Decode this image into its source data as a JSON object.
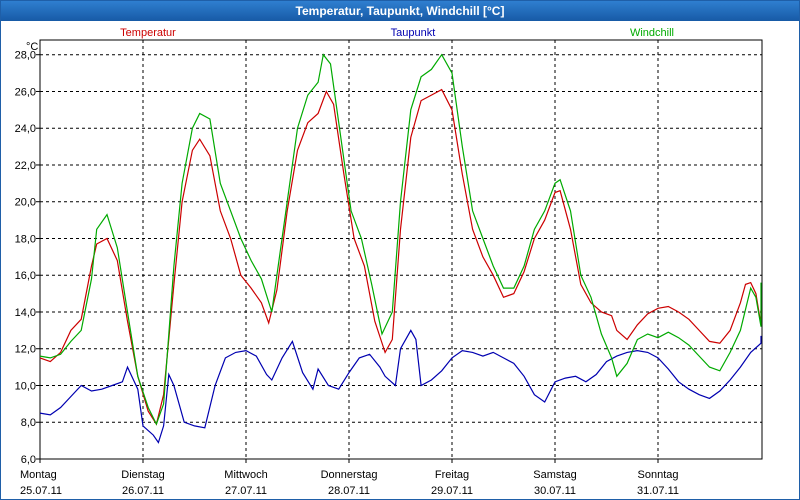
{
  "window": {
    "title": "Temperatur, Taupunkt, Windchill [°C]"
  },
  "chart_data": {
    "type": "line",
    "title": "Temperatur, Taupunkt, Windchill [°C]",
    "ylabel": "°C",
    "ylim": [
      6,
      28.8
    ],
    "yticks": [
      6,
      8,
      10,
      12,
      14,
      16,
      18,
      20,
      22,
      24,
      26,
      28
    ],
    "ytick_labels": [
      "6,0",
      "8,0",
      "10,0",
      "12,0",
      "14,0",
      "16,0",
      "18,0",
      "20,0",
      "22,0",
      "24,0",
      "26,0",
      "28,0"
    ],
    "xlim": [
      0,
      7.05
    ],
    "x_ticks": [
      {
        "x": 0,
        "day": "Montag",
        "date": "25.07.11"
      },
      {
        "x": 1,
        "day": "Dienstag",
        "date": "26.07.11"
      },
      {
        "x": 2,
        "day": "Mittwoch",
        "date": "27.07.11"
      },
      {
        "x": 3,
        "day": "Donnerstag",
        "date": "28.07.11"
      },
      {
        "x": 4,
        "day": "Freitag",
        "date": "29.07.11"
      },
      {
        "x": 5,
        "day": "Samstag",
        "date": "30.07.11"
      },
      {
        "x": 6,
        "day": "Sonntag",
        "date": "31.07.11"
      }
    ],
    "grid": true,
    "legend_position": "top",
    "series": [
      {
        "name": "Temperatur",
        "color": "#cc0000",
        "points": [
          [
            0.0,
            11.5
          ],
          [
            0.1,
            11.3
          ],
          [
            0.2,
            11.8
          ],
          [
            0.3,
            13.0
          ],
          [
            0.4,
            13.6
          ],
          [
            0.5,
            16.5
          ],
          [
            0.55,
            17.7
          ],
          [
            0.65,
            18.0
          ],
          [
            0.75,
            16.8
          ],
          [
            0.85,
            13.5
          ],
          [
            0.95,
            10.5
          ],
          [
            1.05,
            8.6
          ],
          [
            1.13,
            7.9
          ],
          [
            1.2,
            9.5
          ],
          [
            1.3,
            15.5
          ],
          [
            1.38,
            20.0
          ],
          [
            1.48,
            22.8
          ],
          [
            1.55,
            23.4
          ],
          [
            1.65,
            22.5
          ],
          [
            1.75,
            19.5
          ],
          [
            1.85,
            18.0
          ],
          [
            1.95,
            16.0
          ],
          [
            2.05,
            15.3
          ],
          [
            2.15,
            14.5
          ],
          [
            2.22,
            13.4
          ],
          [
            2.3,
            15.2
          ],
          [
            2.4,
            19.5
          ],
          [
            2.5,
            22.8
          ],
          [
            2.6,
            24.3
          ],
          [
            2.7,
            24.8
          ],
          [
            2.78,
            26.0
          ],
          [
            2.85,
            25.3
          ],
          [
            2.95,
            21.5
          ],
          [
            3.05,
            18.0
          ],
          [
            3.15,
            16.5
          ],
          [
            3.25,
            13.5
          ],
          [
            3.35,
            11.8
          ],
          [
            3.42,
            12.5
          ],
          [
            3.5,
            18.5
          ],
          [
            3.6,
            23.5
          ],
          [
            3.7,
            25.5
          ],
          [
            3.8,
            25.8
          ],
          [
            3.9,
            26.1
          ],
          [
            4.0,
            25.0
          ],
          [
            4.1,
            21.5
          ],
          [
            4.2,
            18.5
          ],
          [
            4.3,
            17.0
          ],
          [
            4.4,
            16.0
          ],
          [
            4.5,
            14.8
          ],
          [
            4.6,
            15.0
          ],
          [
            4.7,
            16.2
          ],
          [
            4.8,
            18.0
          ],
          [
            4.9,
            19.0
          ],
          [
            5.0,
            20.5
          ],
          [
            5.05,
            20.6
          ],
          [
            5.15,
            18.5
          ],
          [
            5.25,
            15.5
          ],
          [
            5.35,
            14.5
          ],
          [
            5.45,
            14.0
          ],
          [
            5.55,
            13.8
          ],
          [
            5.6,
            13.0
          ],
          [
            5.7,
            12.5
          ],
          [
            5.8,
            13.3
          ],
          [
            5.9,
            13.9
          ],
          [
            6.0,
            14.2
          ],
          [
            6.1,
            14.3
          ],
          [
            6.2,
            14.0
          ],
          [
            6.3,
            13.6
          ],
          [
            6.4,
            13.0
          ],
          [
            6.5,
            12.4
          ],
          [
            6.6,
            12.3
          ],
          [
            6.7,
            13.0
          ],
          [
            6.8,
            14.5
          ],
          [
            6.85,
            15.5
          ],
          [
            6.9,
            15.6
          ],
          [
            6.95,
            15.0
          ],
          [
            7.0,
            13.3
          ],
          [
            7.05,
            13.5
          ],
          [
            7.15,
            14.1
          ],
          [
            7.25,
            14.0
          ],
          [
            7.35,
            13.6
          ],
          [
            7.45,
            13.5
          ]
        ]
      },
      {
        "name": "Taupunkt",
        "color": "#0000b0",
        "points": [
          [
            0.0,
            8.5
          ],
          [
            0.1,
            8.4
          ],
          [
            0.2,
            8.8
          ],
          [
            0.3,
            9.4
          ],
          [
            0.4,
            10.0
          ],
          [
            0.5,
            9.7
          ],
          [
            0.6,
            9.8
          ],
          [
            0.7,
            10.0
          ],
          [
            0.8,
            10.2
          ],
          [
            0.85,
            11.0
          ],
          [
            0.95,
            9.8
          ],
          [
            1.0,
            7.8
          ],
          [
            1.1,
            7.3
          ],
          [
            1.15,
            6.9
          ],
          [
            1.2,
            7.8
          ],
          [
            1.25,
            10.6
          ],
          [
            1.3,
            10.0
          ],
          [
            1.4,
            8.0
          ],
          [
            1.5,
            7.8
          ],
          [
            1.6,
            7.7
          ],
          [
            1.7,
            10.0
          ],
          [
            1.8,
            11.5
          ],
          [
            1.9,
            11.8
          ],
          [
            2.0,
            11.9
          ],
          [
            2.1,
            11.6
          ],
          [
            2.2,
            10.6
          ],
          [
            2.25,
            10.3
          ],
          [
            2.35,
            11.5
          ],
          [
            2.45,
            12.4
          ],
          [
            2.55,
            10.7
          ],
          [
            2.65,
            9.8
          ],
          [
            2.7,
            10.9
          ],
          [
            2.8,
            10.0
          ],
          [
            2.9,
            9.8
          ],
          [
            3.0,
            10.7
          ],
          [
            3.1,
            11.5
          ],
          [
            3.2,
            11.7
          ],
          [
            3.3,
            11.0
          ],
          [
            3.35,
            10.5
          ],
          [
            3.45,
            10.0
          ],
          [
            3.5,
            12.0
          ],
          [
            3.6,
            13.0
          ],
          [
            3.65,
            12.5
          ],
          [
            3.7,
            10.0
          ],
          [
            3.8,
            10.3
          ],
          [
            3.9,
            10.8
          ],
          [
            4.0,
            11.5
          ],
          [
            4.1,
            11.9
          ],
          [
            4.2,
            11.8
          ],
          [
            4.3,
            11.6
          ],
          [
            4.4,
            11.8
          ],
          [
            4.5,
            11.5
          ],
          [
            4.6,
            11.2
          ],
          [
            4.7,
            10.5
          ],
          [
            4.8,
            9.5
          ],
          [
            4.9,
            9.1
          ],
          [
            5.0,
            10.2
          ],
          [
            5.1,
            10.4
          ],
          [
            5.2,
            10.5
          ],
          [
            5.3,
            10.2
          ],
          [
            5.4,
            10.6
          ],
          [
            5.5,
            11.3
          ],
          [
            5.6,
            11.6
          ],
          [
            5.7,
            11.8
          ],
          [
            5.8,
            11.9
          ],
          [
            5.9,
            11.8
          ],
          [
            6.0,
            11.5
          ],
          [
            6.1,
            10.9
          ],
          [
            6.2,
            10.2
          ],
          [
            6.3,
            9.8
          ],
          [
            6.4,
            9.5
          ],
          [
            6.5,
            9.3
          ],
          [
            6.6,
            9.7
          ],
          [
            6.7,
            10.3
          ],
          [
            6.8,
            11.0
          ],
          [
            6.9,
            11.8
          ],
          [
            7.0,
            12.3
          ],
          [
            7.1,
            12.6
          ],
          [
            7.2,
            12.7
          ],
          [
            7.3,
            12.5
          ],
          [
            7.4,
            12.5
          ],
          [
            7.45,
            12.6
          ]
        ]
      },
      {
        "name": "Windchill",
        "color": "#00aa00",
        "points": [
          [
            0.0,
            11.6
          ],
          [
            0.1,
            11.5
          ],
          [
            0.2,
            11.7
          ],
          [
            0.3,
            12.4
          ],
          [
            0.4,
            13.0
          ],
          [
            0.5,
            15.8
          ],
          [
            0.55,
            18.5
          ],
          [
            0.65,
            19.3
          ],
          [
            0.75,
            17.5
          ],
          [
            0.85,
            14.0
          ],
          [
            0.95,
            10.5
          ],
          [
            1.05,
            8.8
          ],
          [
            1.13,
            7.9
          ],
          [
            1.2,
            9.0
          ],
          [
            1.3,
            16.5
          ],
          [
            1.38,
            21.0
          ],
          [
            1.48,
            24.0
          ],
          [
            1.55,
            24.8
          ],
          [
            1.65,
            24.5
          ],
          [
            1.75,
            21.0
          ],
          [
            1.85,
            19.5
          ],
          [
            1.95,
            18.0
          ],
          [
            2.05,
            16.8
          ],
          [
            2.15,
            15.8
          ],
          [
            2.25,
            14.0
          ],
          [
            2.3,
            16.0
          ],
          [
            2.4,
            20.0
          ],
          [
            2.5,
            24.0
          ],
          [
            2.6,
            25.8
          ],
          [
            2.7,
            26.5
          ],
          [
            2.75,
            28.0
          ],
          [
            2.82,
            27.5
          ],
          [
            2.92,
            23.5
          ],
          [
            3.02,
            19.5
          ],
          [
            3.12,
            18.0
          ],
          [
            3.22,
            15.5
          ],
          [
            3.32,
            12.8
          ],
          [
            3.42,
            14.0
          ],
          [
            3.5,
            20.0
          ],
          [
            3.6,
            25.0
          ],
          [
            3.7,
            26.8
          ],
          [
            3.8,
            27.2
          ],
          [
            3.9,
            28.0
          ],
          [
            4.0,
            27.0
          ],
          [
            4.1,
            23.0
          ],
          [
            4.2,
            19.5
          ],
          [
            4.3,
            18.0
          ],
          [
            4.4,
            16.5
          ],
          [
            4.5,
            15.3
          ],
          [
            4.6,
            15.3
          ],
          [
            4.7,
            16.5
          ],
          [
            4.8,
            18.5
          ],
          [
            4.9,
            19.5
          ],
          [
            5.0,
            21.0
          ],
          [
            5.05,
            21.2
          ],
          [
            5.15,
            19.5
          ],
          [
            5.25,
            16.0
          ],
          [
            5.35,
            14.8
          ],
          [
            5.45,
            12.8
          ],
          [
            5.55,
            11.5
          ],
          [
            5.6,
            10.5
          ],
          [
            5.7,
            11.2
          ],
          [
            5.8,
            12.5
          ],
          [
            5.9,
            12.8
          ],
          [
            6.0,
            12.6
          ],
          [
            6.1,
            12.9
          ],
          [
            6.2,
            12.6
          ],
          [
            6.3,
            12.2
          ],
          [
            6.4,
            11.6
          ],
          [
            6.5,
            11.0
          ],
          [
            6.6,
            10.8
          ],
          [
            6.7,
            11.8
          ],
          [
            6.8,
            13.0
          ],
          [
            6.9,
            15.3
          ],
          [
            6.95,
            14.8
          ],
          [
            7.0,
            13.2
          ],
          [
            7.05,
            13.5
          ],
          [
            7.15,
            14.5
          ],
          [
            7.25,
            15.0
          ],
          [
            7.3,
            15.6
          ],
          [
            7.35,
            14.8
          ],
          [
            7.4,
            15.2
          ],
          [
            7.45,
            15.2
          ]
        ]
      }
    ]
  }
}
